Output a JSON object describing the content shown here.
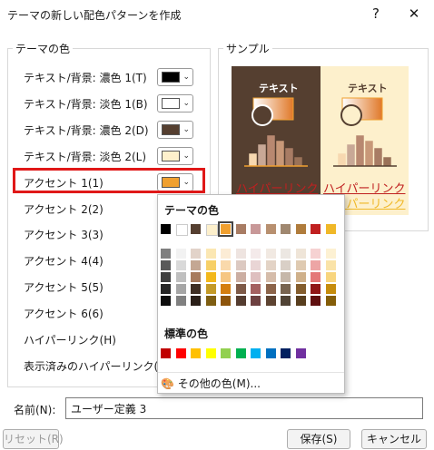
{
  "window": {
    "title": "テーマの新しい配色パターンを作成",
    "help_glyph": "?",
    "close_glyph": "✕"
  },
  "theme_colors_group": {
    "label": "テーマの色",
    "rows": [
      {
        "label": "テキスト/背景: 濃色 1(T)",
        "color": "#000000"
      },
      {
        "label": "テキスト/背景: 淡色 1(B)",
        "color": "#ffffff"
      },
      {
        "label": "テキスト/背景: 濃色 2(D)",
        "color": "#553f30"
      },
      {
        "label": "テキスト/背景: 淡色 2(L)",
        "color": "#fdf0cc"
      },
      {
        "label": "アクセント 1(1)",
        "color": "#f0a030"
      },
      {
        "label": "アクセント 2(2)"
      },
      {
        "label": "アクセント 3(3)"
      },
      {
        "label": "アクセント 4(4)"
      },
      {
        "label": "アクセント 5(5)"
      },
      {
        "label": "アクセント 6(6)"
      },
      {
        "label": "ハイパーリンク(H)"
      },
      {
        "label": "表示済みのハイパーリンク(F)"
      }
    ]
  },
  "sample": {
    "label": "サンプル",
    "dark_text": "テキスト",
    "light_text": "テキスト",
    "link_text": "ハイパーリンク",
    "visited_text": "ハイパーリンク"
  },
  "palette": {
    "theme_label": "テーマの色",
    "standard_label": "標準の色",
    "more_colors": "その他の色(M)...",
    "theme_row": [
      "#000000",
      "#ffffff",
      "#553f30",
      "#fdf0cc",
      "#f0a030",
      "#a87c64",
      "#c89898",
      "#b89070",
      "#a08870",
      "#b07c3c",
      "#c02020",
      "#f0b828"
    ],
    "shades": [
      [
        "#7f7f7f",
        "#f2f2f2",
        "#e2d3c9",
        "#fbe7b3",
        "#fcecd5",
        "#eee4e0",
        "#f4eaea",
        "#f1e9e2",
        "#ece7e2",
        "#efe5d8",
        "#f6d2d2",
        "#fdf1d3"
      ],
      [
        "#595959",
        "#d9d9d9",
        "#c4a793",
        "#f7d067",
        "#f9d9ab",
        "#dcc9c1",
        "#e9d5d5",
        "#e3d3c6",
        "#d9cfc6",
        "#dfcab1",
        "#eda5a5",
        "#fae3a8"
      ],
      [
        "#3f3f3f",
        "#bfbfbf",
        "#a77b5d",
        "#f3b81b",
        "#f6c682",
        "#cbaea2",
        "#debfbf",
        "#d5bcaa",
        "#c6b7a9",
        "#cfb08a",
        "#e47878",
        "#f8d57e"
      ],
      [
        "#262626",
        "#a6a6a6",
        "#3f2f24",
        "#c49a27",
        "#d47e10",
        "#7e5a48",
        "#a46060",
        "#8c644a",
        "#786450",
        "#845d2d",
        "#901818",
        "#c68c0c"
      ],
      [
        "#0d0d0d",
        "#808080",
        "#2a1f18",
        "#7e5e12",
        "#8d540b",
        "#543c30",
        "#6d4040",
        "#5d4331",
        "#504335",
        "#583e1e",
        "#601010",
        "#845d08"
      ]
    ],
    "standard": [
      "#c00000",
      "#ff0000",
      "#ffc000",
      "#ffff00",
      "#92d050",
      "#00b050",
      "#00b0f0",
      "#0070c0",
      "#002060",
      "#7030a0"
    ],
    "selected_index": 4
  },
  "name_field": {
    "label": "名前(N):",
    "value": "ユーザー定義 3"
  },
  "buttons": {
    "reset": "リセット(R)",
    "save": "保存(S)",
    "cancel": "キャンセル"
  },
  "chart_colors": [
    "#f7d8b0",
    "#c8a896",
    "#b88870",
    "#c89878",
    "#a87c64",
    "#9a7258"
  ]
}
